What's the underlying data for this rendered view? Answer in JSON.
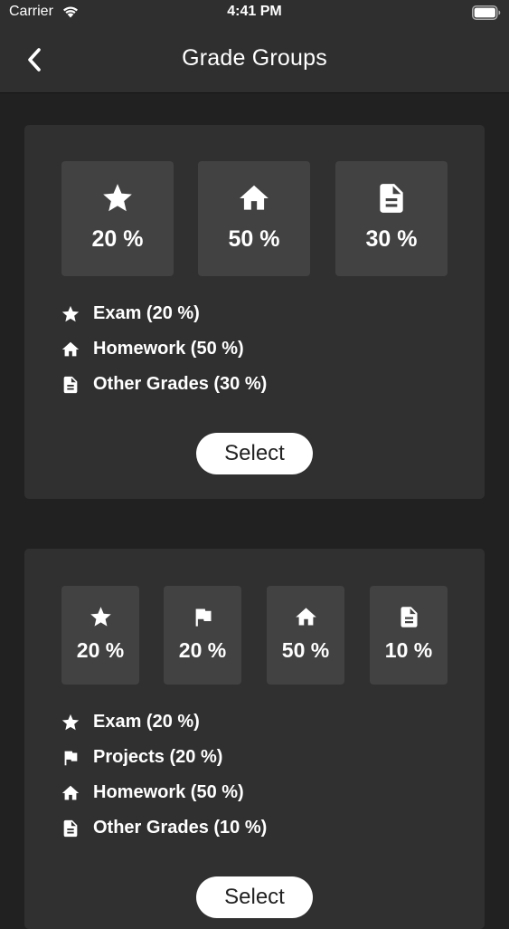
{
  "status_bar": {
    "carrier": "Carrier",
    "time": "4:41 PM"
  },
  "nav": {
    "title": "Grade Groups",
    "back_icon": "chevron-left-icon"
  },
  "colors": {
    "background": "#212121",
    "bar": "#2f2f2f",
    "card": "#303030",
    "tile": "#424242",
    "text": "#ffffff",
    "button": "#ffffff"
  },
  "groups": [
    {
      "tiles": [
        {
          "icon": "star-icon",
          "value": "20 %"
        },
        {
          "icon": "home-icon",
          "value": "50 %"
        },
        {
          "icon": "document-icon",
          "value": "30 %"
        }
      ],
      "legend": [
        {
          "icon": "star-icon",
          "label": "Exam (20 %)"
        },
        {
          "icon": "home-icon",
          "label": "Homework (50 %)"
        },
        {
          "icon": "document-icon",
          "label": "Other Grades (30 %)"
        }
      ],
      "select_label": "Select"
    },
    {
      "tiles": [
        {
          "icon": "star-icon",
          "value": "20 %"
        },
        {
          "icon": "flag-icon",
          "value": "20 %"
        },
        {
          "icon": "home-icon",
          "value": "50 %"
        },
        {
          "icon": "document-icon",
          "value": "10 %"
        }
      ],
      "legend": [
        {
          "icon": "star-icon",
          "label": "Exam (20 %)"
        },
        {
          "icon": "flag-icon",
          "label": "Projects (20 %)"
        },
        {
          "icon": "home-icon",
          "label": "Homework (50 %)"
        },
        {
          "icon": "document-icon",
          "label": "Other Grades (10 %)"
        }
      ],
      "select_label": "Select"
    }
  ]
}
